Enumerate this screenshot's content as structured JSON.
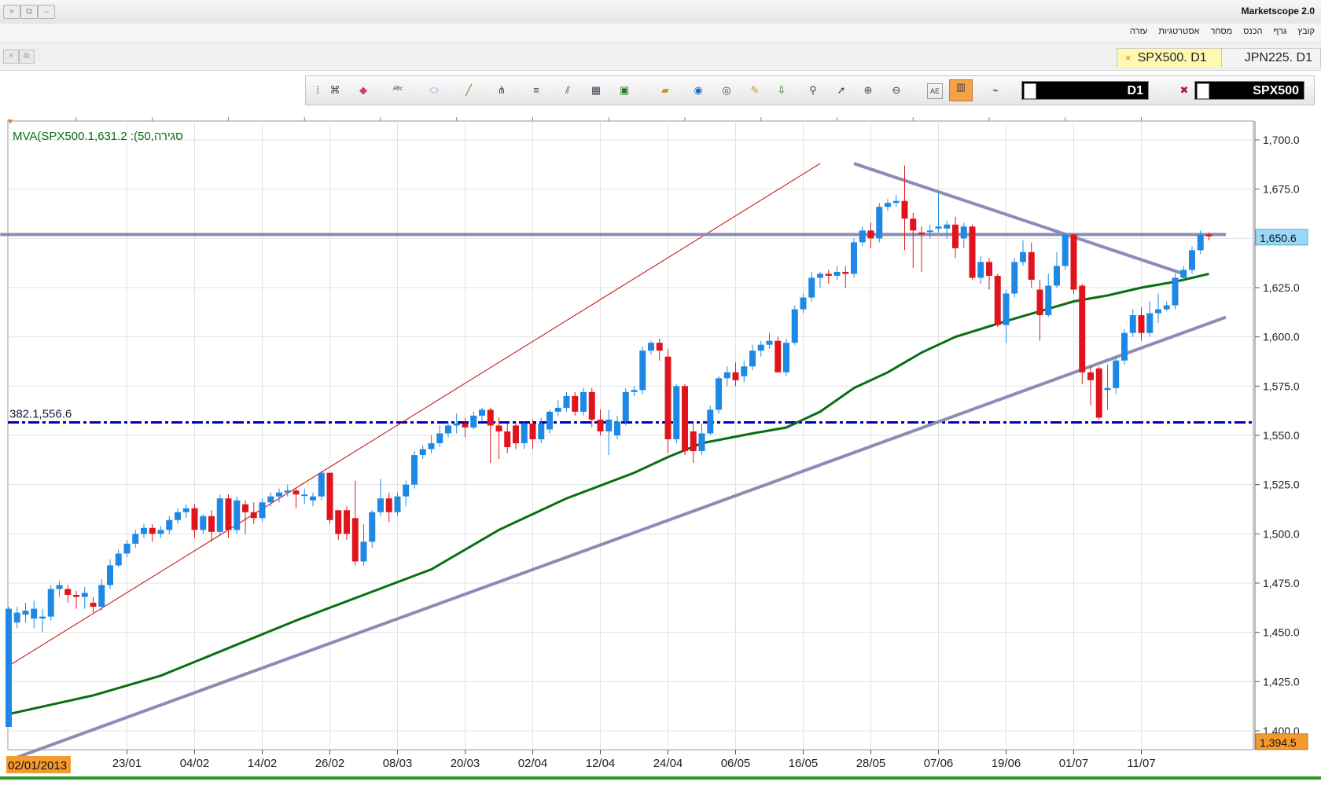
{
  "window": {
    "title": "Marketscope 2.0",
    "menu": [
      "קובץ",
      "גרף",
      "הכנס",
      "מסחר",
      "אסטרטגיות",
      "עזרה"
    ]
  },
  "tabs": [
    {
      "label": "SPX500. D1",
      "active": true
    },
    {
      "label": "JPN225. D1",
      "active": false
    }
  ],
  "toolbar": {
    "timeframe": "D1",
    "symbol": "SPX500",
    "tools": [
      "pin-icon",
      "tree-icon",
      "eraser-icon",
      "text-tool-icon",
      "ellipse-icon",
      "line-icon",
      "fork-icon",
      "lines-icon",
      "parallel-icon",
      "chart-window-icon",
      "picture-icon",
      "ruler-icon",
      "globe-icon",
      "eye-icon",
      "edit-icon",
      "download-icon",
      "zoom-icon",
      "cursor-icon",
      "cursor-zoom-icon",
      "cursor-zoom-out-icon",
      "pane-icon",
      "grid-icon",
      "indicator-icon",
      "hide-icon"
    ]
  },
  "chart_data": {
    "type": "candlestick",
    "indicator_label": "MVA(SPX500.1,631.2 :(50,סגירה",
    "fib_label": "382.1,556.6",
    "current_price_label": "1,650.6",
    "low_price_label": "1,394.5",
    "start_date_label": "02/01/2013",
    "y_ticks": [
      "1,700.0",
      "1,675.0",
      "1,650.0",
      "1,625.0",
      "1,600.0",
      "1,575.0",
      "1,550.0",
      "1,525.0",
      "1,500.0",
      "1,475.0",
      "1,450.0",
      "1,425.0",
      "1,400.0"
    ],
    "y_tick_values": [
      1700,
      1675,
      1650,
      1625,
      1600,
      1575,
      1550,
      1525,
      1500,
      1475,
      1450,
      1425,
      1400
    ],
    "x_labels": [
      {
        "label": "23/01",
        "index": 14
      },
      {
        "label": "04/02",
        "index": 22
      },
      {
        "label": "14/02",
        "index": 30
      },
      {
        "label": "26/02",
        "index": 38
      },
      {
        "label": "08/03",
        "index": 46
      },
      {
        "label": "20/03",
        "index": 54
      },
      {
        "label": "02/04",
        "index": 62
      },
      {
        "label": "12/04",
        "index": 70
      },
      {
        "label": "24/04",
        "index": 78
      },
      {
        "label": "06/05",
        "index": 86
      },
      {
        "label": "16/05",
        "index": 94
      },
      {
        "label": "28/05",
        "index": 102
      },
      {
        "label": "07/06",
        "index": 110
      },
      {
        "label": "19/06",
        "index": 118
      },
      {
        "label": "01/07",
        "index": 126
      },
      {
        "label": "11/07",
        "index": 134
      }
    ],
    "ylim": [
      1390,
      1705
    ],
    "candles": [
      [
        1402,
        1462,
        1404,
        1463
      ],
      [
        1455,
        1460,
        1452,
        1463
      ],
      [
        1459,
        1461,
        1455,
        1465
      ],
      [
        1457,
        1462,
        1452,
        1466
      ],
      [
        1457,
        1458,
        1450,
        1462
      ],
      [
        1458,
        1472,
        1456,
        1474
      ],
      [
        1472,
        1474,
        1468,
        1476
      ],
      [
        1472,
        1469,
        1465,
        1474
      ],
      [
        1469,
        1468,
        1462,
        1471
      ],
      [
        1468,
        1470,
        1462,
        1473
      ],
      [
        1465,
        1463,
        1460,
        1468
      ],
      [
        1463,
        1474,
        1461,
        1477
      ],
      [
        1474,
        1484,
        1472,
        1487
      ],
      [
        1484,
        1490,
        1483,
        1492
      ],
      [
        1490,
        1495,
        1488,
        1497
      ],
      [
        1495,
        1500,
        1493,
        1502
      ],
      [
        1500,
        1503,
        1498,
        1505
      ],
      [
        1503,
        1500,
        1496,
        1505
      ],
      [
        1500,
        1502,
        1498,
        1504
      ],
      [
        1502,
        1507,
        1500,
        1509
      ],
      [
        1507,
        1511,
        1505,
        1513
      ],
      [
        1511,
        1513,
        1508,
        1515
      ],
      [
        1513,
        1502,
        1498,
        1515
      ],
      [
        1502,
        1509,
        1500,
        1510
      ],
      [
        1509,
        1501,
        1496,
        1512
      ],
      [
        1501,
        1518,
        1499,
        1520
      ],
      [
        1518,
        1502,
        1498,
        1520
      ],
      [
        1502,
        1517,
        1500,
        1519
      ],
      [
        1515,
        1511,
        1500,
        1517
      ],
      [
        1511,
        1508,
        1505,
        1516
      ],
      [
        1508,
        1516,
        1506,
        1518
      ],
      [
        1516,
        1519,
        1514,
        1521
      ],
      [
        1519,
        1521,
        1516,
        1523
      ],
      [
        1521,
        1522,
        1519,
        1525
      ],
      [
        1522,
        1520,
        1513,
        1523
      ],
      [
        1520,
        1520,
        1515,
        1523
      ],
      [
        1517,
        1519,
        1514,
        1521
      ],
      [
        1519,
        1531,
        1517,
        1532
      ],
      [
        1531,
        1507,
        1505,
        1530
      ],
      [
        1512,
        1500,
        1497,
        1512
      ],
      [
        1512,
        1500,
        1497,
        1514
      ],
      [
        1508,
        1486,
        1484,
        1527
      ],
      [
        1486,
        1496,
        1484,
        1505
      ],
      [
        1496,
        1511,
        1493,
        1512
      ],
      [
        1511,
        1518,
        1509,
        1528
      ],
      [
        1518,
        1511,
        1506,
        1521
      ],
      [
        1511,
        1519,
        1509,
        1521
      ],
      [
        1519,
        1525,
        1514,
        1527
      ],
      [
        1525,
        1540,
        1523,
        1542
      ],
      [
        1540,
        1543,
        1538,
        1545
      ],
      [
        1543,
        1546,
        1541,
        1550
      ],
      [
        1546,
        1551,
        1544,
        1555
      ],
      [
        1551,
        1555,
        1549,
        1557
      ],
      [
        1555,
        1556,
        1551,
        1561
      ],
      [
        1556,
        1554,
        1549,
        1559
      ],
      [
        1554,
        1560,
        1553,
        1562
      ],
      [
        1560,
        1563,
        1557,
        1564
      ],
      [
        1563,
        1555,
        1536,
        1564
      ],
      [
        1555,
        1552,
        1538,
        1559
      ],
      [
        1552,
        1544,
        1541,
        1556
      ],
      [
        1555,
        1546,
        1543,
        1557
      ],
      [
        1546,
        1556,
        1543,
        1557
      ],
      [
        1556,
        1548,
        1543,
        1558
      ],
      [
        1548,
        1556,
        1546,
        1559
      ],
      [
        1553,
        1562,
        1551,
        1563
      ],
      [
        1562,
        1564,
        1560,
        1568
      ],
      [
        1564,
        1570,
        1562,
        1572
      ],
      [
        1570,
        1562,
        1560,
        1572
      ],
      [
        1562,
        1572,
        1560,
        1574
      ],
      [
        1572,
        1558,
        1554,
        1574
      ],
      [
        1558,
        1552,
        1550,
        1563
      ],
      [
        1552,
        1558,
        1540,
        1563
      ],
      [
        1550,
        1557,
        1548,
        1560
      ],
      [
        1557,
        1572,
        1555,
        1574
      ],
      [
        1572,
        1573,
        1570,
        1575
      ],
      [
        1573,
        1593,
        1571,
        1595
      ],
      [
        1593,
        1597,
        1591,
        1598
      ],
      [
        1597,
        1593,
        1588,
        1599
      ],
      [
        1590,
        1548,
        1541,
        1594
      ],
      [
        1548,
        1575,
        1546,
        1576
      ],
      [
        1575,
        1542,
        1540,
        1576
      ],
      [
        1552,
        1542,
        1536,
        1556
      ],
      [
        1542,
        1551,
        1540,
        1556
      ],
      [
        1551,
        1563,
        1550,
        1565
      ],
      [
        1563,
        1579,
        1561,
        1580
      ],
      [
        1579,
        1582,
        1575,
        1585
      ],
      [
        1582,
        1578,
        1575,
        1587
      ],
      [
        1580,
        1585,
        1577,
        1588
      ],
      [
        1585,
        1593,
        1583,
        1596
      ],
      [
        1593,
        1596,
        1590,
        1598
      ],
      [
        1596,
        1598,
        1594,
        1602
      ],
      [
        1598,
        1582,
        1582,
        1600
      ],
      [
        1582,
        1597,
        1580,
        1599
      ],
      [
        1597,
        1614,
        1596,
        1616
      ],
      [
        1614,
        1620,
        1612,
        1622
      ],
      [
        1620,
        1630,
        1618,
        1633
      ],
      [
        1630,
        1632,
        1625,
        1633
      ],
      [
        1632,
        1631,
        1627,
        1634
      ],
      [
        1631,
        1633,
        1629,
        1636
      ],
      [
        1633,
        1632,
        1625,
        1636
      ],
      [
        1632,
        1648,
        1630,
        1650
      ],
      [
        1648,
        1654,
        1646,
        1656
      ],
      [
        1654,
        1650,
        1645,
        1658
      ],
      [
        1650,
        1666,
        1648,
        1668
      ],
      [
        1666,
        1668,
        1664,
        1670
      ],
      [
        1668,
        1669,
        1666,
        1672
      ],
      [
        1669,
        1660,
        1644,
        1687
      ],
      [
        1660,
        1654,
        1635,
        1663
      ],
      [
        1653,
        1652,
        1633,
        1656
      ],
      [
        1654,
        1654,
        1650,
        1657
      ],
      [
        1655,
        1656,
        1653,
        1673
      ],
      [
        1655,
        1657,
        1650,
        1659
      ],
      [
        1657,
        1645,
        1640,
        1661
      ],
      [
        1650,
        1656,
        1645,
        1658
      ],
      [
        1656,
        1630,
        1629,
        1657
      ],
      [
        1630,
        1638,
        1627,
        1641
      ],
      [
        1638,
        1631,
        1624,
        1640
      ],
      [
        1631,
        1606,
        1605,
        1632
      ],
      [
        1606,
        1622,
        1597,
        1624
      ],
      [
        1622,
        1638,
        1620,
        1640
      ],
      [
        1638,
        1643,
        1636,
        1649
      ],
      [
        1643,
        1629,
        1625,
        1648
      ],
      [
        1624,
        1611,
        1598,
        1629
      ],
      [
        1611,
        1626,
        1610,
        1632
      ],
      [
        1626,
        1636,
        1625,
        1643
      ],
      [
        1636,
        1652,
        1634,
        1653
      ],
      [
        1652,
        1624,
        1622,
        1652
      ],
      [
        1626,
        1582,
        1576,
        1627
      ],
      [
        1582,
        1578,
        1565,
        1585
      ],
      [
        1584,
        1559,
        1558,
        1585
      ],
      [
        1573,
        1574,
        1563,
        1586
      ],
      [
        1574,
        1588,
        1571,
        1590
      ],
      [
        1588,
        1602,
        1586,
        1604
      ],
      [
        1602,
        1611,
        1600,
        1614
      ],
      [
        1611,
        1602,
        1598,
        1615
      ],
      [
        1602,
        1612,
        1600,
        1618
      ],
      [
        1612,
        1614,
        1607,
        1622
      ],
      [
        1614,
        1616,
        1613,
        1618
      ],
      [
        1616,
        1630,
        1614,
        1632
      ],
      [
        1630,
        1634,
        1628,
        1636
      ],
      [
        1634,
        1644,
        1632,
        1646
      ],
      [
        1644,
        1652,
        1642,
        1654
      ],
      [
        1652,
        1651,
        1649,
        1653
      ]
    ],
    "ma50": [
      [
        0,
        1408.5
      ],
      [
        10,
        1418
      ],
      [
        18,
        1428
      ],
      [
        26,
        1442
      ],
      [
        34,
        1456
      ],
      [
        42,
        1469
      ],
      [
        50,
        1482
      ],
      [
        58,
        1502
      ],
      [
        66,
        1518
      ],
      [
        74,
        1531
      ],
      [
        78,
        1539
      ],
      [
        82,
        1546
      ],
      [
        88,
        1551
      ],
      [
        92,
        1554
      ],
      [
        96,
        1562
      ],
      [
        100,
        1574
      ],
      [
        104,
        1582
      ],
      [
        108,
        1592
      ],
      [
        112,
        1600
      ],
      [
        118,
        1608
      ],
      [
        122,
        1613
      ],
      [
        126,
        1618
      ],
      [
        130,
        1621
      ],
      [
        134,
        1625
      ],
      [
        138,
        1628
      ],
      [
        142,
        1632
      ]
    ],
    "trendlines": [
      {
        "from": [
          0,
          1433
        ],
        "to": [
          96,
          1688
        ],
        "color": "#cc0000",
        "width": 1
      },
      {
        "from": [
          0,
          1385
        ],
        "to": [
          144,
          1610
        ],
        "color": "#8c8cb4",
        "width": 4
      },
      {
        "from": [
          100,
          1688
        ],
        "to": [
          139,
          1632
        ],
        "color": "#8c8cb4",
        "width": 4
      },
      {
        "from": [
          -1,
          1652
        ],
        "to": [
          144,
          1652
        ],
        "color": "#8c8cb4",
        "width": 4
      }
    ],
    "fib_level": 1556.6,
    "colors": {
      "up": "#1e88e5",
      "down": "#e0141c",
      "ma": "#0a6e14",
      "fib": "#0000b4",
      "trend": "#8c8cb4",
      "trend_red": "#cc0000",
      "price_tag": "#9ad8f5",
      "low_tag": "#f59a2e"
    }
  }
}
